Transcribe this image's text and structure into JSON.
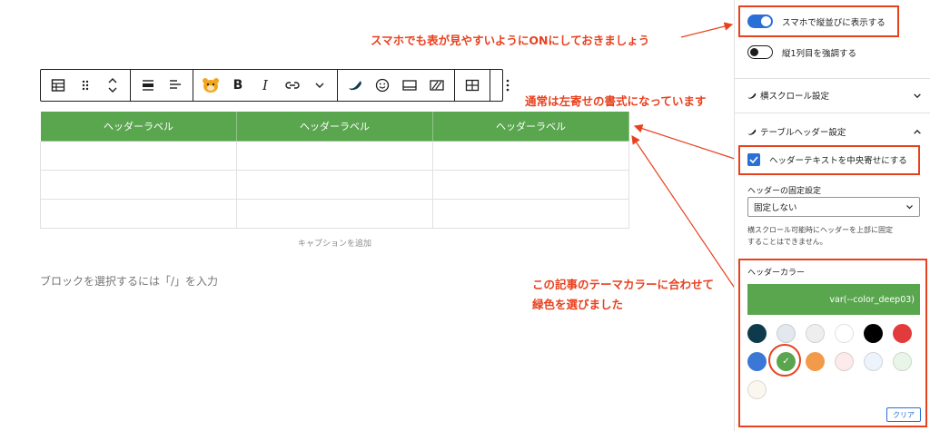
{
  "annotations": {
    "note1": "スマホでも表が見やすいようにONにしておきましょう",
    "note2": "通常は左寄せの書式になっています",
    "note3_line1": "この記事のテーマカラーに合わせて",
    "note3_line2": "緑色を選びました"
  },
  "toolbar": {
    "bold_label": "B",
    "italic_label": "I",
    "icons": [
      "table-icon",
      "drag-handle-icon",
      "move-up-down-icon",
      "align-icon",
      "text-align-icon",
      "mascot-icon",
      "bold-icon",
      "italic-icon",
      "link-icon",
      "chevron-down-icon",
      "marker-icon",
      "emoji-icon",
      "frame-icon",
      "strikethrough-box-icon",
      "table-edit-icon",
      "more-options-icon"
    ]
  },
  "table": {
    "headers": [
      "ヘッダーラベル",
      "ヘッダーラベル",
      "ヘッダーラベル"
    ],
    "rows": [
      [
        "",
        "",
        ""
      ],
      [
        "",
        "",
        ""
      ],
      [
        "",
        "",
        ""
      ]
    ],
    "header_color": "#5aa64f"
  },
  "editor": {
    "caption_placeholder": "キャプションを追加",
    "block_hint": "ブロックを選択するには「/」を入力"
  },
  "sidebar": {
    "toggle_mobile_vertical": {
      "label": "スマホで縦並びに表示する",
      "on": true
    },
    "toggle_first_column": {
      "label": "縦1列目を強調する",
      "on": false
    },
    "panel_horizontal_scroll": "横スクロール設定",
    "panel_table_header": "テーブルヘッダー設定",
    "checkbox_center_header": {
      "label": "ヘッダーテキストを中央寄せにする",
      "checked": true
    },
    "header_fixed_label": "ヘッダーの固定設定",
    "header_fixed_select": "固定しない",
    "help_line1": "横スクロール可能時にヘッダーを上部に固定",
    "help_line2": "することはできません。",
    "header_color_label": "ヘッダーカラー",
    "color_value": "var(--color_deep03)",
    "swatches": [
      "#0d3a4d",
      "#e3e8ef",
      "#eeeeee",
      "#ffffff",
      "#000000",
      "#e33b3b",
      "#3b78d6",
      "#5aa64f",
      "#f2994a",
      "#fdeaea",
      "#edf3fb",
      "#e9f5e9",
      "#fbf7ee"
    ],
    "selected_swatch": 7,
    "clear_label": "クリア"
  },
  "colors": {
    "accent": "#e8411e",
    "primary": "#2a6fd6",
    "green": "#5aa64f"
  }
}
